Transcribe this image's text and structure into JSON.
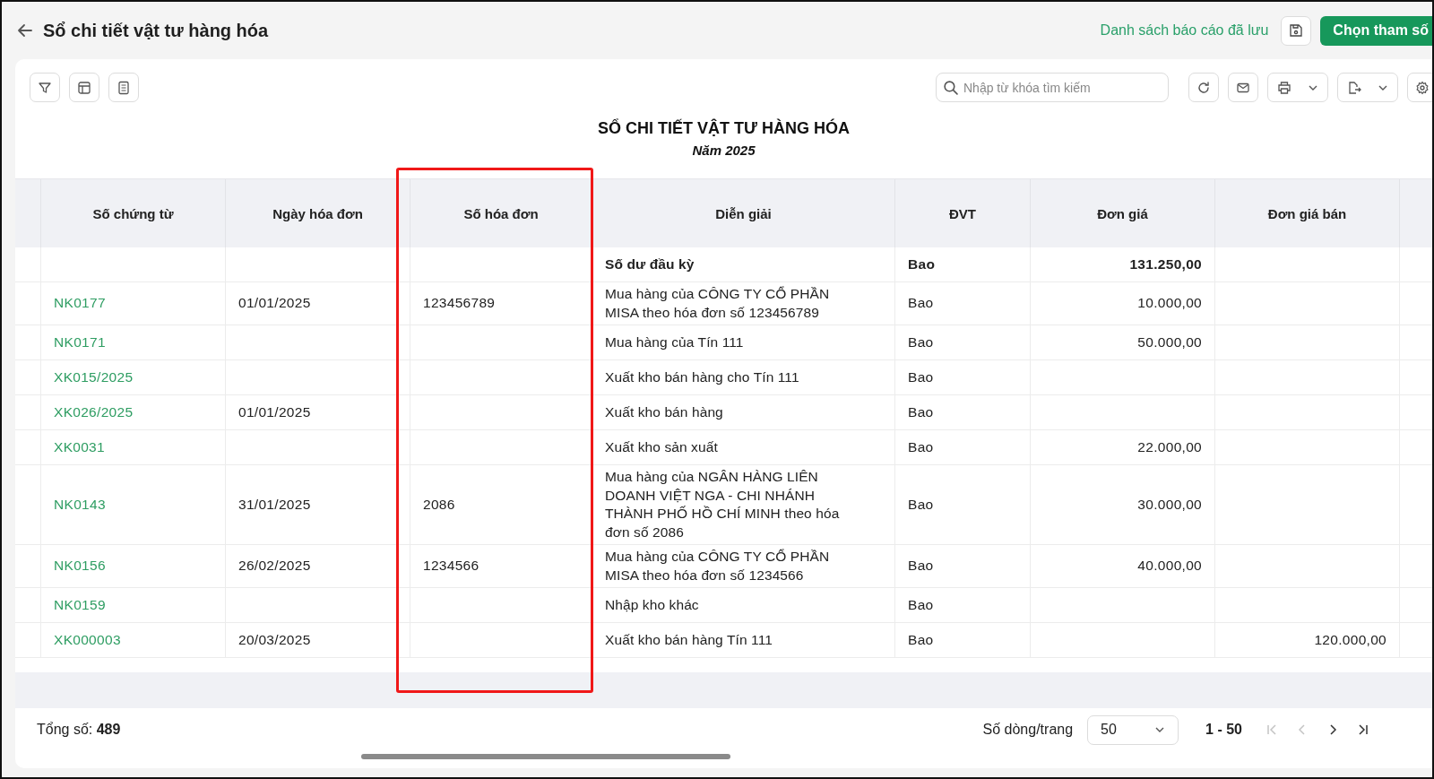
{
  "header": {
    "title": "Sổ chi tiết vật tư hàng hóa",
    "saved_reports_link": "Danh sách báo cáo đã lưu",
    "choose_params_button": "Chọn tham số"
  },
  "search": {
    "placeholder": "Nhập từ khóa tìm kiếm"
  },
  "report": {
    "title": "SỔ CHI TIẾT VẬT TƯ HÀNG HÓA",
    "subtitle": "Năm 2025"
  },
  "table": {
    "columns": [
      {
        "label": "Số chứng từ",
        "highlighted": false
      },
      {
        "label": "Ngày hóa đơn",
        "highlighted": false
      },
      {
        "label": "Số hóa đơn",
        "highlighted": true
      },
      {
        "label": "Diễn giải",
        "highlighted": false
      },
      {
        "label": "ĐVT",
        "highlighted": false
      },
      {
        "label": "Đơn giá",
        "highlighted": false
      },
      {
        "label": "Đơn giá bán",
        "highlighted": false
      }
    ],
    "rows": [
      {
        "kind": "opening",
        "voucher": "",
        "date": "",
        "invoice": "",
        "description": "Số dư đầu kỳ",
        "unit": "Bao",
        "price": "131.250,00",
        "sale_price": ""
      },
      {
        "kind": "entry",
        "voucher": "NK0177",
        "date": "01/01/2025",
        "invoice": "123456789",
        "description": "Mua hàng của CÔNG TY CỔ PHẦN MISA theo hóa đơn số 123456789",
        "unit": "Bao",
        "price": "10.000,00",
        "sale_price": ""
      },
      {
        "kind": "entry",
        "voucher": "NK0171",
        "date": "",
        "invoice": "",
        "description": "Mua hàng của Tín 111",
        "unit": "Bao",
        "price": "50.000,00",
        "sale_price": ""
      },
      {
        "kind": "entry",
        "voucher": "XK015/2025",
        "date": "",
        "invoice": "",
        "description": "Xuất kho bán hàng cho Tín 111",
        "unit": "Bao",
        "price": "",
        "sale_price": ""
      },
      {
        "kind": "entry",
        "voucher": "XK026/2025",
        "date": "01/01/2025",
        "invoice": "",
        "description": "Xuất kho bán hàng",
        "unit": "Bao",
        "price": "",
        "sale_price": ""
      },
      {
        "kind": "entry",
        "voucher": "XK0031",
        "date": "",
        "invoice": "",
        "description": "Xuất kho sản xuất",
        "unit": "Bao",
        "price": "22.000,00",
        "sale_price": ""
      },
      {
        "kind": "entry",
        "voucher": "NK0143",
        "date": "31/01/2025",
        "invoice": "2086",
        "description": "Mua hàng của NGÂN HÀNG LIÊN DOANH VIỆT NGA - CHI NHÁNH THÀNH PHỐ HỒ CHÍ MINH theo hóa đơn số 2086",
        "unit": "Bao",
        "price": "30.000,00",
        "sale_price": ""
      },
      {
        "kind": "entry",
        "voucher": "NK0156",
        "date": "26/02/2025",
        "invoice": "1234566",
        "description": "Mua hàng của CÔNG TY CỔ PHẦN MISA theo hóa đơn số 1234566",
        "unit": "Bao",
        "price": "40.000,00",
        "sale_price": ""
      },
      {
        "kind": "entry",
        "voucher": "NK0159",
        "date": "",
        "invoice": "",
        "description": "Nhập kho khác",
        "unit": "Bao",
        "price": "",
        "sale_price": ""
      },
      {
        "kind": "entry",
        "voucher": "XK000003",
        "date": "20/03/2025",
        "invoice": "",
        "description": "Xuất kho bán hàng Tín 111",
        "unit": "Bao",
        "price": "",
        "sale_price": "120.000,00"
      }
    ]
  },
  "footer": {
    "total": "Tổng số: **489**",
    "rows_per_page_label": "Số dòng/trang",
    "rows_per_page": "50",
    "range": "1 - 50",
    "pager": [
      {
        "kind": "first",
        "disabled": true
      },
      {
        "kind": "prev",
        "disabled": true
      },
      {
        "kind": "next",
        "disabled": false
      },
      {
        "kind": "last",
        "disabled": false
      }
    ]
  }
}
